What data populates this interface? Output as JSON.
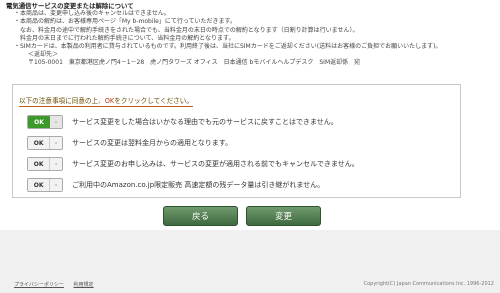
{
  "notice": {
    "title": "電気通信サービスの変更または解除について",
    "lines": [
      "・本商品は、変更申し込み後のキャンセルはできません。",
      "・本商品の解約は、お客様専用ページ「My b-mobile」にて行っていただきます。",
      "なお、料金月の途中で解約手続きをされた場合でも、当料金月の末日の時点での解約となります（日割り計算は行いません）。",
      "料金月の末日までに行われた解約手続きについて、当料金月の解約となります。",
      "・SIMカードは、本製品の利用者に貸与されているものです。利用終了後は、当社にSIMカードをご返却ください(送料はお客様のご負担でお願いいたします)。",
      "＜返却先＞",
      "〒105-0001　東京都港区虎ノ門4－1－28　虎ノ門タワーズ オフィス　日本通信 bモバイルヘルプデスク　SIM返却係　宛"
    ]
  },
  "instruction": {
    "prefix": "以下の注意事項に同意の上、",
    "ok": "OK",
    "suffix": "をクリックしてください。"
  },
  "consent_rows": [
    {
      "state": "on",
      "ok_label": "OK",
      "x_label": "-",
      "text": "サービス変更をした場合はいかなる理由でも元のサービスに戻すことはできません。"
    },
    {
      "state": "off",
      "ok_label": "OK",
      "x_label": "-",
      "text": "サービスの変更は翌料金月からの適用となります。"
    },
    {
      "state": "off",
      "ok_label": "OK",
      "x_label": "-",
      "text": "サービス変更のお申し込みは、サービスの変更が適用される前でもキャンセルできません。"
    },
    {
      "state": "off",
      "ok_label": "OK",
      "x_label": "-",
      "text": "ご利用中のAmazon.co.jp限定販売 高速定額の残データ量は引き継がれません。"
    }
  ],
  "buttons": {
    "back": "戻る",
    "change": "変更"
  },
  "footer": {
    "links": [
      "プライバシーポリシー",
      "利用規定"
    ],
    "copyright": "Copyright(C) Japan Communications Inc. 1996-2012"
  },
  "colors": {
    "accent_green": "#3c9a2c",
    "button_green": "#4f7a4f",
    "underline": "#c75b1b"
  }
}
